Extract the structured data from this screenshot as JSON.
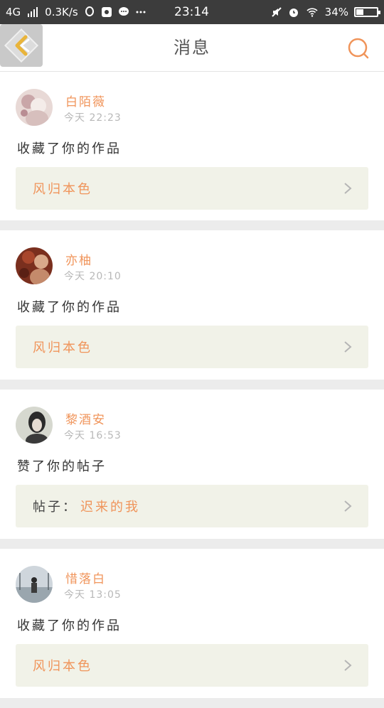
{
  "status_bar": {
    "network": "4G",
    "speed": "0.3K/s",
    "time": "23:14",
    "battery": "34%",
    "battery_level": 0.34
  },
  "header": {
    "title": "消息"
  },
  "colors": {
    "accent": "#f0945a",
    "ref_bg": "#f1f2e8",
    "separator": "#ececec"
  },
  "notifications": [
    {
      "user": "白陌薇",
      "time": "今天 22:23",
      "action": "收藏了你的作品",
      "ref_prefix": "",
      "ref_text": "风归本色"
    },
    {
      "user": "亦柚",
      "time": "今天 20:10",
      "action": "收藏了你的作品",
      "ref_prefix": "",
      "ref_text": "风归本色"
    },
    {
      "user": "黎酒安",
      "time": "今天 16:53",
      "action": "赞了你的帖子",
      "ref_prefix": "帖子：",
      "ref_text": "迟来的我"
    },
    {
      "user": "惜落白",
      "time": "今天 13:05",
      "action": "收藏了你的作品",
      "ref_prefix": "",
      "ref_text": "风归本色"
    }
  ]
}
